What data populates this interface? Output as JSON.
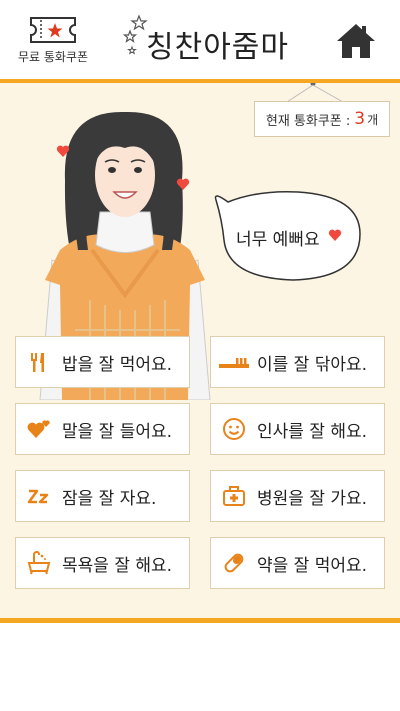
{
  "header": {
    "coupon_label": "무료 통화쿠폰",
    "title": "칭찬아줌마"
  },
  "coupon_count": {
    "label": "현재 통화쿠폰 : ",
    "value": "3",
    "unit": "개"
  },
  "speech_bubble": {
    "text": "너무 예뻐요"
  },
  "praise_buttons": [
    {
      "label": "밥을 잘 먹어요.",
      "icon": "fork-knife-icon"
    },
    {
      "label": "이를 잘 닦아요.",
      "icon": "toothbrush-icon"
    },
    {
      "label": "말을 잘 들어요.",
      "icon": "hearts-icon"
    },
    {
      "label": "인사를 잘 해요.",
      "icon": "smiley-icon"
    },
    {
      "label": "잠을 잘 자요.",
      "icon": "sleep-zz-icon"
    },
    {
      "label": "병원을 잘 가요.",
      "icon": "first-aid-kit-icon"
    },
    {
      "label": "목욕을 잘 해요.",
      "icon": "bathtub-icon"
    },
    {
      "label": "약을 잘 먹어요.",
      "icon": "pill-icon"
    }
  ],
  "colors": {
    "accent": "#f5a623",
    "icon_orange": "#e8831a",
    "background": "#fdf5e4",
    "count_red": "#e03a1e",
    "heart_red": "#f04a3e"
  }
}
